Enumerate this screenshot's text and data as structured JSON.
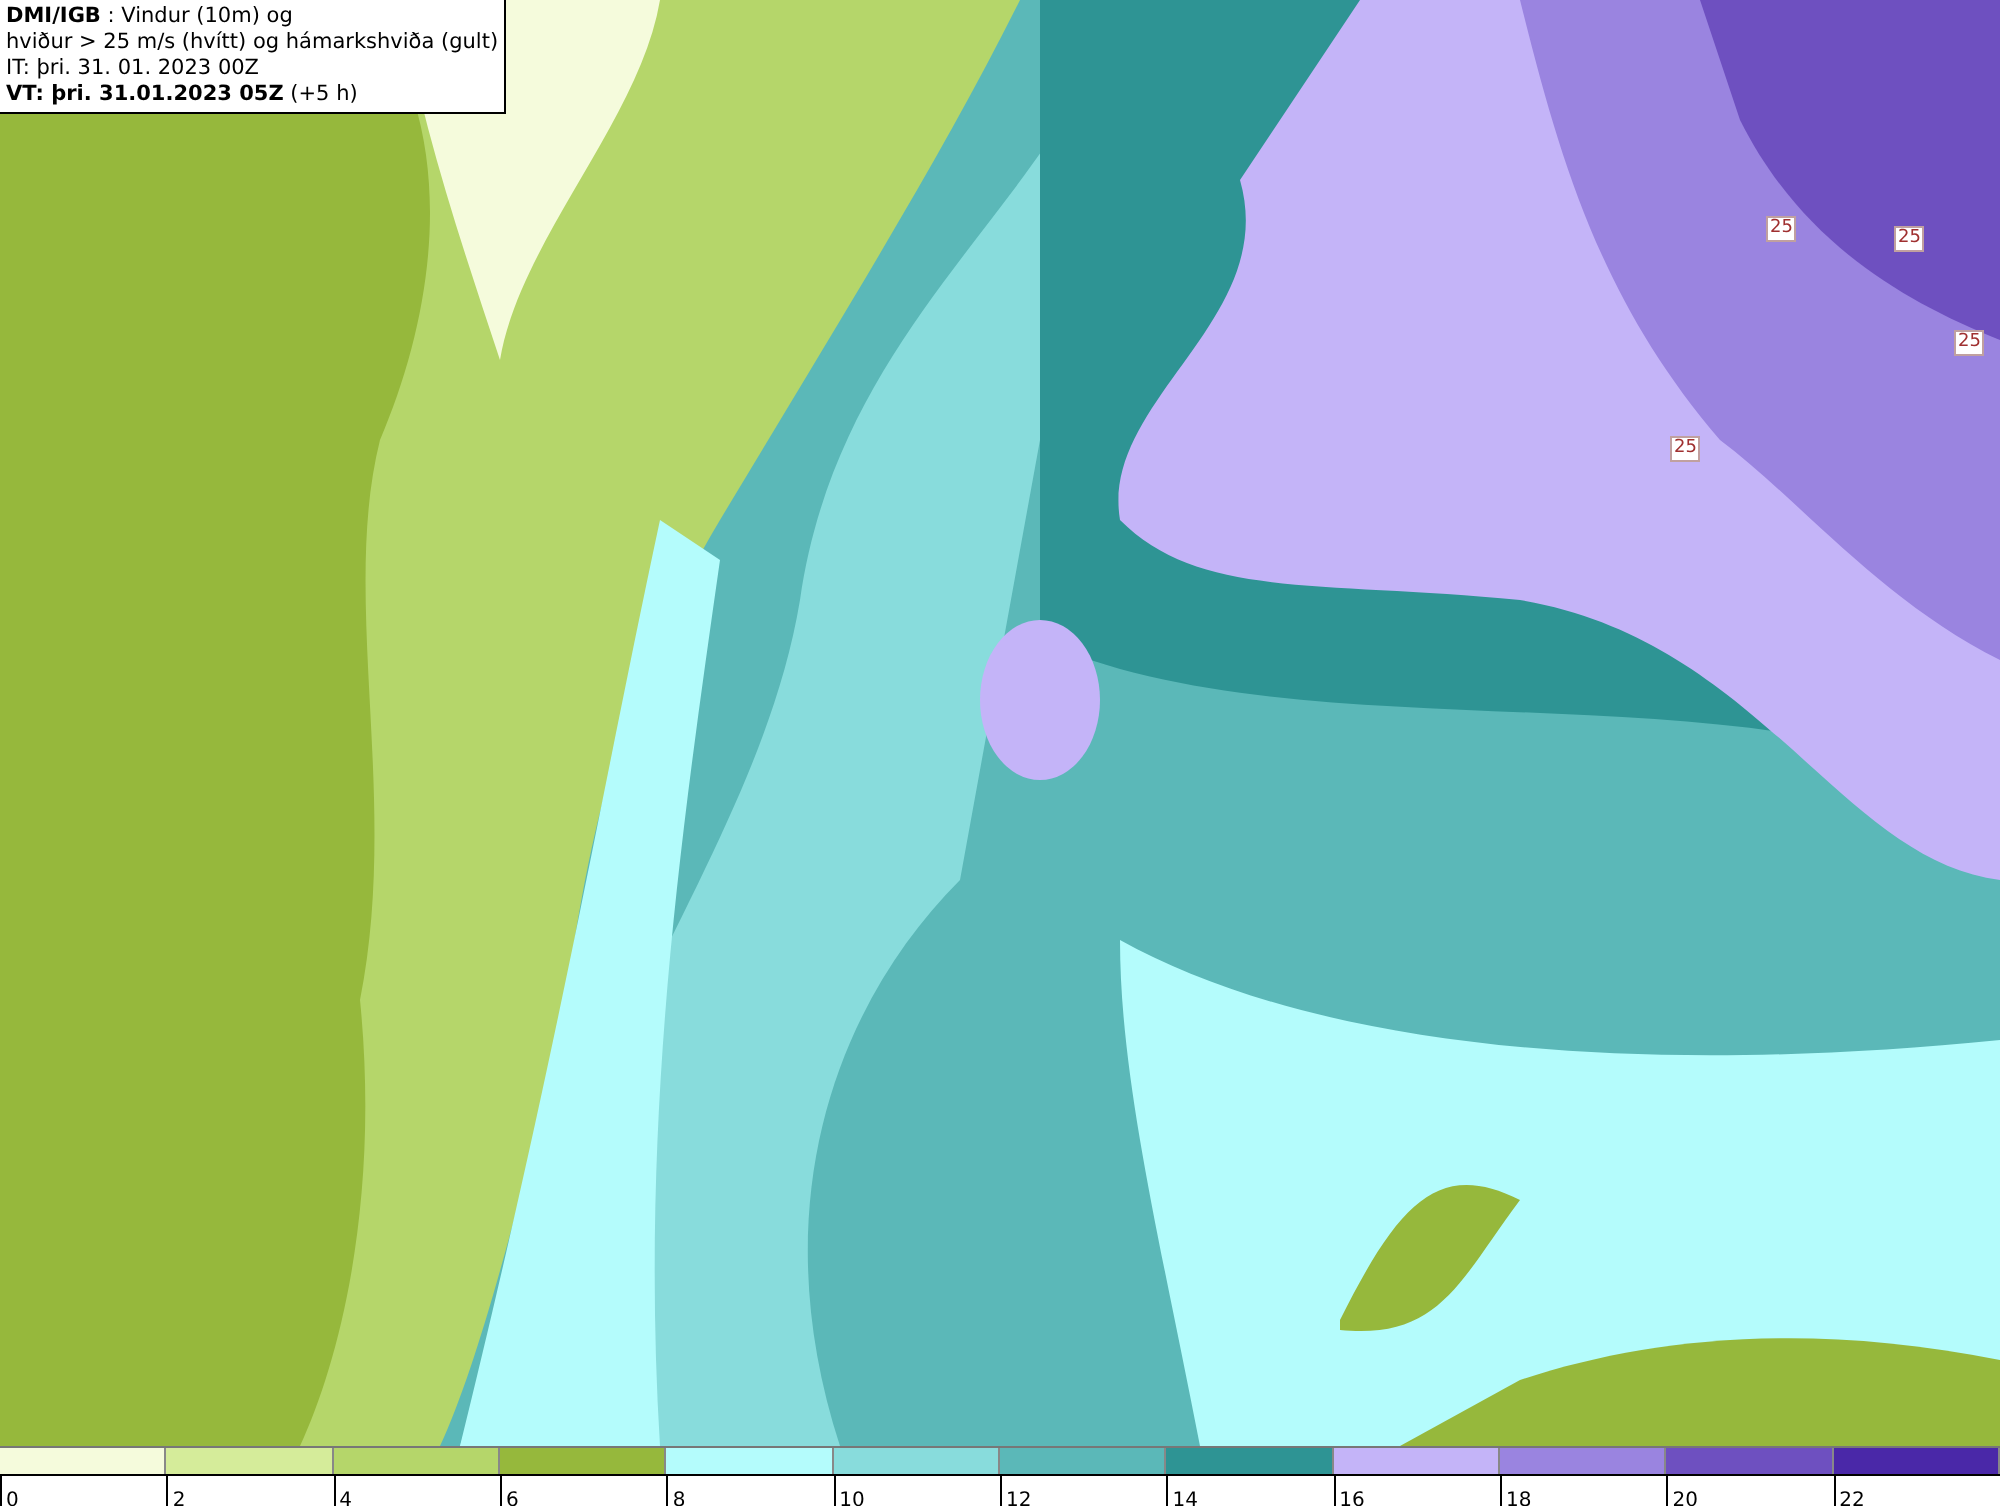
{
  "header": {
    "lines": [
      "**DMI/IGB** : Vindur (10m) og",
      "hviður > 25 m/s (hvítt) og hámarkshviða (gult)",
      "IT: þri. 31. 01. 2023 00Z",
      "**VT: þri. 31.01.2023 05Z** (+5 h)"
    ]
  },
  "map": {
    "contour_labels": [
      "25",
      "25",
      "25",
      "25"
    ]
  },
  "legend": [
    {
      "label": "0",
      "color": "#f5fbdc"
    },
    {
      "label": "2",
      "color": "#d5ec9a"
    },
    {
      "label": "4",
      "color": "#b5d66a"
    },
    {
      "label": "6",
      "color": "#96b83c"
    },
    {
      "label": "8",
      "color": "#b4fcfc"
    },
    {
      "label": "10",
      "color": "#88dcdc"
    },
    {
      "label": "12",
      "color": "#5bb8b8"
    },
    {
      "label": "14",
      "color": "#2e9494"
    },
    {
      "label": "16",
      "color": "#c4b4f8"
    },
    {
      "label": "18",
      "color": "#9a84e0"
    },
    {
      "label": "20",
      "color": "#6e50c0"
    },
    {
      "label": "22",
      "color": "#4a28a8"
    }
  ]
}
